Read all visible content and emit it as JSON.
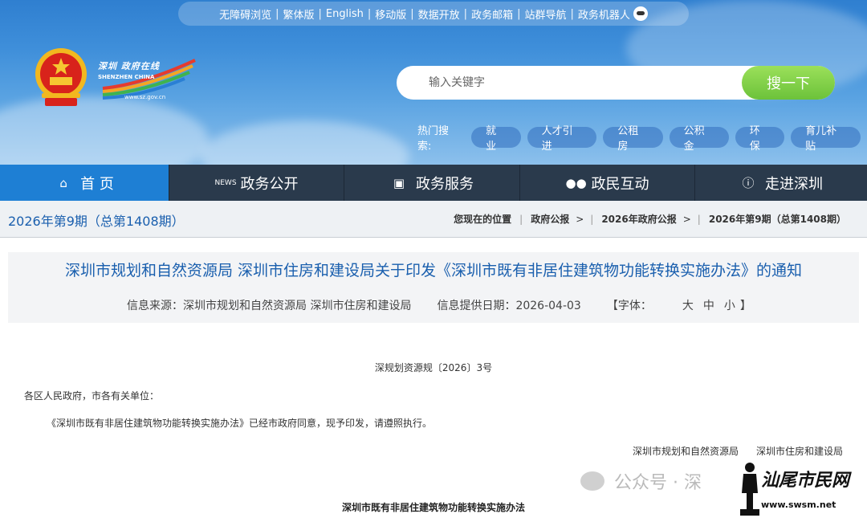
{
  "topbar": {
    "links": [
      "无障碍浏览",
      "繁体版",
      "English",
      "移动版",
      "数据开放",
      "政务邮箱",
      "站群导航",
      "政务机器人"
    ]
  },
  "logo": {
    "cn": "深圳 政府在线",
    "en": "SHENZHEN CHINA",
    "url": "www.sz.gov.cn"
  },
  "search": {
    "placeholder": "输入关键字",
    "button": "搜一下"
  },
  "hot": {
    "label": "热门搜索:",
    "tags": [
      "就业",
      "人才引进",
      "公租房",
      "公积金",
      "环保",
      "育儿补贴"
    ]
  },
  "nav": [
    {
      "label": "首 页",
      "icon": "home-icon"
    },
    {
      "label": "政务公开",
      "icon": "news-icon"
    },
    {
      "label": "政务服务",
      "icon": "monitor-icon"
    },
    {
      "label": "政民互动",
      "icon": "people-icon"
    },
    {
      "label": "走进深圳",
      "icon": "info-icon"
    }
  ],
  "crumb": {
    "issue": "2026年第9期（总第1408期）",
    "location": "您现在的位置",
    "items": [
      "政府公报",
      "2026年政府公报",
      "2026年第9期（总第1408期）"
    ]
  },
  "article": {
    "title": "深圳市规划和自然资源局 深圳市住房和建设局关于印发《深圳市既有非居住建筑物功能转换实施办法》的通知",
    "source": "信息来源：深圳市规划和自然资源局 深圳市住房和建设局",
    "date": "信息提供日期：2026-04-03",
    "font_label": "【字体：",
    "font_sizes": [
      "大",
      "中",
      "小"
    ],
    "font_close": "】",
    "doc_no": "深规划资源规〔2026〕3号",
    "greeting": "各区人民政府，市各有关单位：",
    "body": "《深圳市既有非居住建筑物功能转换实施办法》已经市政府同意，现予印发，请遵照执行。",
    "signer1": "深圳市规划和自然资源局",
    "signer2": "深圳市住房和建设局",
    "doc_title": "深圳市既有非居住建筑物功能转换实施办法"
  },
  "watermark": {
    "text1": "公众号 · 深",
    "text2": "汕尾市民网",
    "url": "www.swsm.net"
  },
  "colors": {
    "nav_bg": "#2a3a4c",
    "nav_active": "#1e7fd4",
    "title_blue": "#1a5fae",
    "search_green": "#7ccb45"
  }
}
